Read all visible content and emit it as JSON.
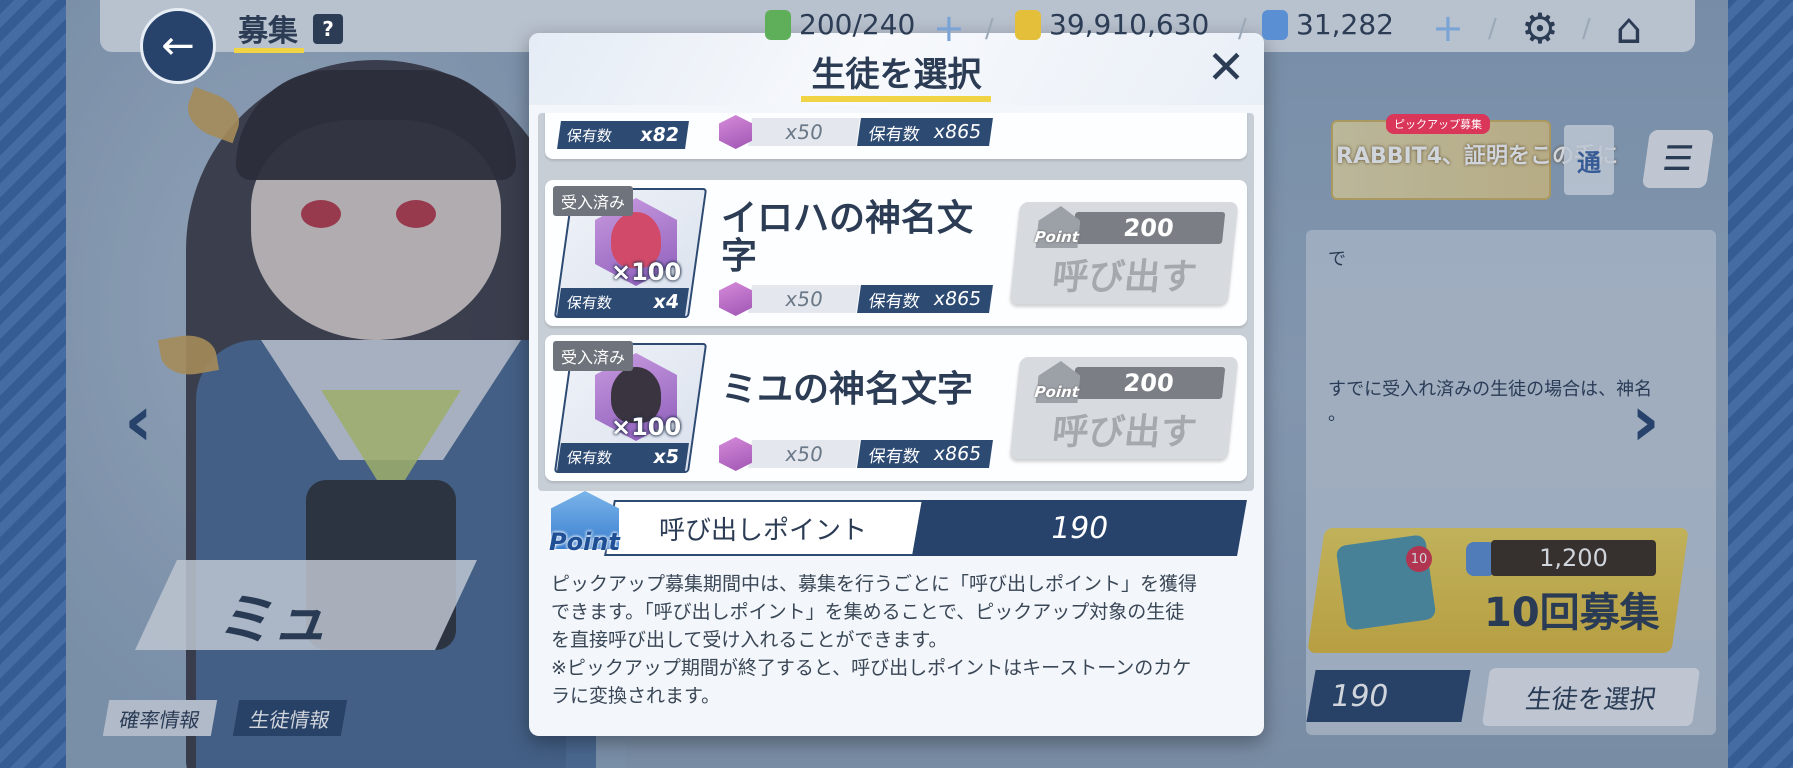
{
  "header": {
    "title": "募集",
    "help_label": "?",
    "ap": "200/240",
    "credits": "39,910,630",
    "pyroxene": "31,282"
  },
  "character": {
    "name": "ミュ"
  },
  "right_panel": {
    "banner_tag": "ピックアップ募集",
    "banner_text": "RABBIT4、証明をこの手に",
    "tab_label": "通",
    "info_line1": "で",
    "info_line2": "すでに受入れ済みの生徒の場合は、神名",
    "info_line3": "。",
    "ticket_count": "10",
    "recruit_cost": "1,200",
    "recruit_label": "10回募集",
    "points_value": "190",
    "select_student_label": "生徒を選択"
  },
  "bottom_tabs": {
    "rate_info": "確率情報",
    "student_info": "生徒情報"
  },
  "modal": {
    "title": "生徒を選択",
    "partial_row": {
      "owned_label": "保有数",
      "owned_value": "x82",
      "need": "x50",
      "cost_owned_label": "保有数",
      "cost_owned_value": "x865"
    },
    "rows": [
      {
        "tag": "受入済み",
        "multiplier": "×100",
        "owned_label": "保有数",
        "owned_value": "x4",
        "name": "イロハの神名文字",
        "need": "x50",
        "cost_owned_label": "保有数",
        "cost_owned_value": "x865",
        "point_icon_text": "Point",
        "point_cost": "200",
        "call_label": "呼び出す"
      },
      {
        "tag": "受入済み",
        "multiplier": "×100",
        "owned_label": "保有数",
        "owned_value": "x5",
        "name": "ミユの神名文字",
        "need": "x50",
        "cost_owned_label": "保有数",
        "cost_owned_value": "x865",
        "point_icon_text": "Point",
        "point_cost": "200",
        "call_label": "呼び出す"
      }
    ],
    "points": {
      "icon_text": "Point",
      "label": "呼び出しポイント",
      "value": "190"
    },
    "description": [
      "ピックアップ募集期間中は、募集を行うごとに「呼び出しポイント」を獲得",
      "できます。「呼び出しポイント」を集めることで、ピックアップ対象の生徒",
      "を直接呼び出して受け入れることができます。",
      "※ピックアップ期間が終了すると、呼び出しポイントはキーストーンのカケ",
      "ラに変換されます。"
    ]
  },
  "colors": {
    "navy": "#27436b",
    "accent_yellow": "#f0d445",
    "received_tag": "#6f747c"
  },
  "icons": {
    "back": "arrow-left",
    "settings": "gear",
    "home": "house",
    "close": "x-mark"
  }
}
